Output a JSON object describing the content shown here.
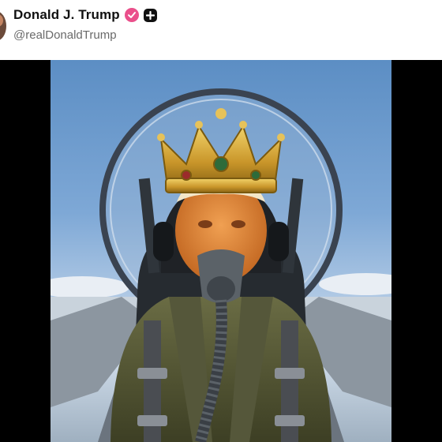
{
  "post": {
    "author_name": "Donald J. Trump",
    "author_handle": "@realDonaldTrump",
    "verified_icon": "verified-badge-icon",
    "follow_icon": "plus-icon"
  },
  "media": {
    "type": "image",
    "icon": "ai-generated-image"
  },
  "colors": {
    "verified": "#ea4f8b",
    "handle": "#6a6a6a",
    "letterbox": "#000000"
  }
}
